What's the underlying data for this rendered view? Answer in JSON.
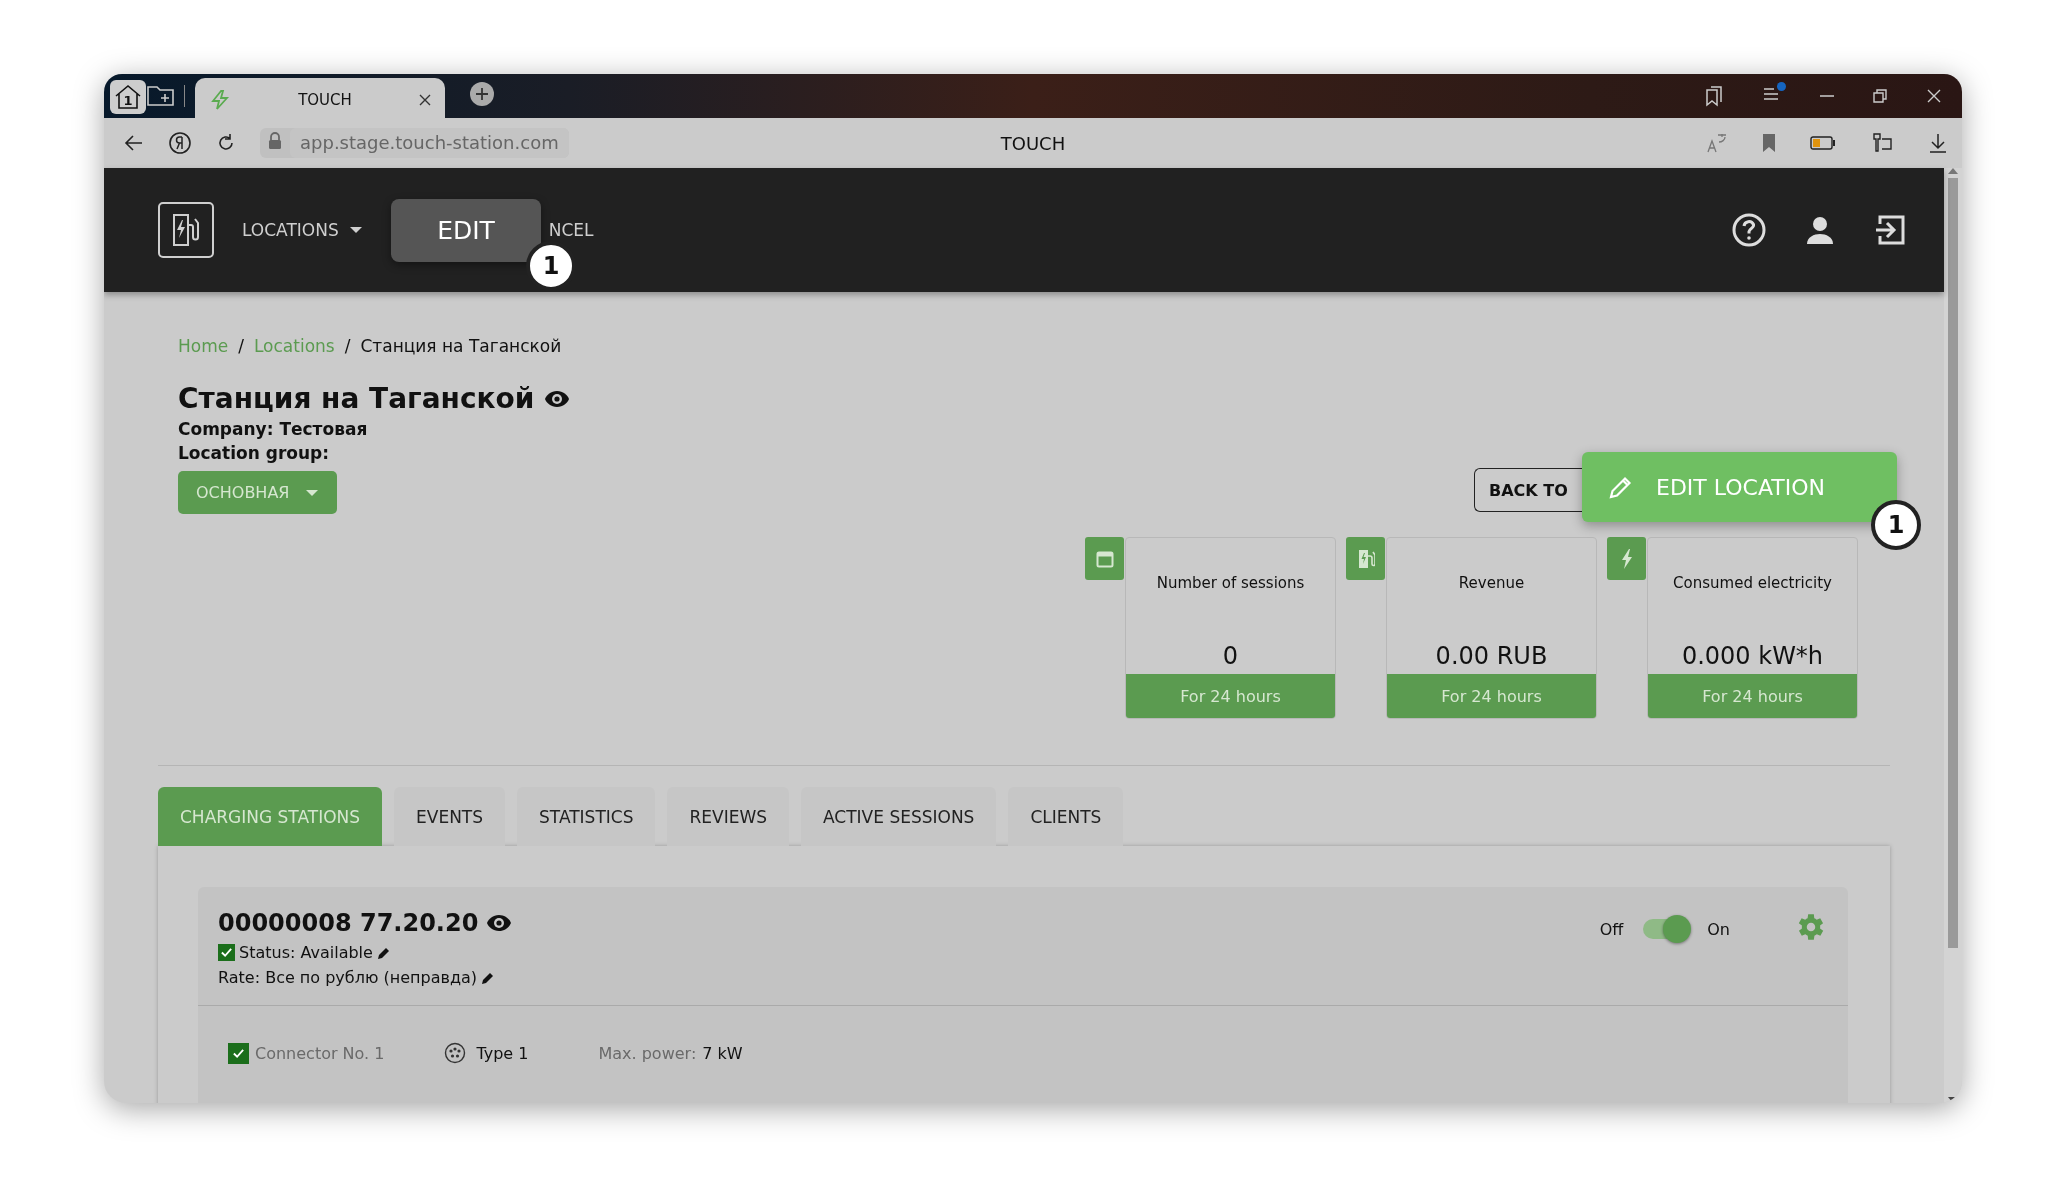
{
  "browser": {
    "home_badge": "1",
    "tab_title": "TOUCH",
    "url": "app.stage.touch-station.com",
    "page_title": "TOUCH",
    "notification": true
  },
  "header": {
    "nav": [
      {
        "label": "LOCATIONS",
        "kind": "dropdown"
      },
      {
        "label": "NCEL",
        "kind": "link"
      }
    ]
  },
  "callouts": [
    {
      "label": "EDIT",
      "number": "1"
    },
    {
      "label": "EDIT LOCATION",
      "number": "1"
    }
  ],
  "breadcrumb": [
    {
      "label": "Home",
      "kind": "link"
    },
    {
      "label": "/",
      "kind": "separator"
    },
    {
      "label": "Locations",
      "kind": "link"
    },
    {
      "label": "/",
      "kind": "separator"
    },
    {
      "label": "Станция на Таганской",
      "kind": "current"
    }
  ],
  "location": {
    "title": "Станция на Таганской",
    "company": "Company: Тестовая",
    "group_label": "Location group:",
    "group": "ОСНОВНАЯ"
  },
  "back_button": "BACK TO",
  "stats": [
    {
      "title": "Number of sessions",
      "value": "0",
      "period": "For 24 hours"
    },
    {
      "title": "Revenue",
      "value": "0.00 RUB",
      "period": "For 24 hours"
    },
    {
      "title": "Consumed electricity",
      "value": "0.000 kW*h",
      "period": "For 24 hours"
    }
  ],
  "tabs": [
    {
      "label": "CHARGING STATIONS",
      "selected": true
    },
    {
      "label": "EVENTS",
      "selected": false
    },
    {
      "label": "STATISTICS",
      "selected": false
    },
    {
      "label": "REVIEWS",
      "selected": false
    },
    {
      "label": "ACTIVE SESSIONS",
      "selected": false
    },
    {
      "label": "CLIENTS",
      "selected": false
    }
  ],
  "station": {
    "title": "00000008 77.20.20",
    "status": "Status: Available",
    "status_checked": true,
    "rate": "Rate: Все по рублю (неправда)",
    "off_label": "Off",
    "on_label": "On",
    "enabled": true,
    "connector": {
      "label": "Connector No. 1",
      "checked": true,
      "type": "Type 1",
      "power_label": "Max. power:",
      "power": "7 kW"
    }
  }
}
